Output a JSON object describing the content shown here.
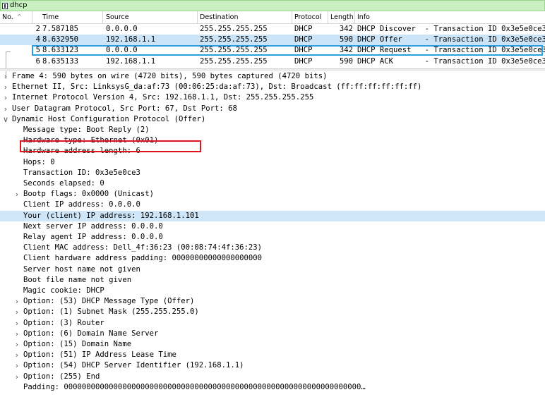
{
  "filter": {
    "value": "dhcp"
  },
  "packet_list": {
    "columns": [
      "No.",
      "Time",
      "Source",
      "Destination",
      "Protocol",
      "Length",
      "Info"
    ],
    "rows": [
      {
        "no": "2",
        "time": "7.587185",
        "source": "0.0.0.0",
        "destination": "255.255.255.255",
        "protocol": "DHCP",
        "length": "342",
        "info": "DHCP Discover  - Transaction ID 0x3e5e0ce3"
      },
      {
        "no": "4",
        "time": "8.632950",
        "source": "192.168.1.1",
        "destination": "255.255.255.255",
        "protocol": "DHCP",
        "length": "590",
        "info": "DHCP Offer     - Transaction ID 0x3e5e0ce3"
      },
      {
        "no": "5",
        "time": "8.633123",
        "source": "0.0.0.0",
        "destination": "255.255.255.255",
        "protocol": "DHCP",
        "length": "342",
        "info": "DHCP Request   - Transaction ID 0x3e5e0ce3"
      },
      {
        "no": "6",
        "time": "8.635133",
        "source": "192.168.1.1",
        "destination": "255.255.255.255",
        "protocol": "DHCP",
        "length": "590",
        "info": "DHCP ACK       - Transaction ID 0x3e5e0ce3"
      }
    ]
  },
  "details": [
    {
      "text": "Frame 4: 590 bytes on wire (4720 bits), 590 bytes captured (4720 bits)",
      "expander": "collapsed"
    },
    {
      "text": "Ethernet II, Src: LinksysG_da:af:73 (00:06:25:da:af:73), Dst: Broadcast (ff:ff:ff:ff:ff:ff)",
      "expander": "collapsed"
    },
    {
      "text": "Internet Protocol Version 4, Src: 192.168.1.1, Dst: 255.255.255.255",
      "expander": "collapsed"
    },
    {
      "text": "User Datagram Protocol, Src Port: 67, Dst Port: 68",
      "expander": "collapsed"
    },
    {
      "text": "Dynamic Host Configuration Protocol (Offer)",
      "expander": "expanded"
    },
    {
      "text": "Message type: Boot Reply (2)",
      "expander": "none"
    },
    {
      "text": "Hardware type: Ethernet (0x01)",
      "expander": "none"
    },
    {
      "text": "Hardware address length: 6",
      "expander": "none"
    },
    {
      "text": "Hops: 0",
      "expander": "none"
    },
    {
      "text": "Transaction ID: 0x3e5e0ce3",
      "expander": "none"
    },
    {
      "text": "Seconds elapsed: 0",
      "expander": "none"
    },
    {
      "text": "Bootp flags: 0x0000 (Unicast)",
      "expander": "collapsed"
    },
    {
      "text": "Client IP address: 0.0.0.0",
      "expander": "none"
    },
    {
      "text": "Your (client) IP address: 192.168.1.101",
      "expander": "none"
    },
    {
      "text": "Next server IP address: 0.0.0.0",
      "expander": "none"
    },
    {
      "text": "Relay agent IP address: 0.0.0.0",
      "expander": "none"
    },
    {
      "text": "Client MAC address: Dell_4f:36:23 (00:08:74:4f:36:23)",
      "expander": "none"
    },
    {
      "text": "Client hardware address padding: 00000000000000000000",
      "expander": "none"
    },
    {
      "text": "Server host name not given",
      "expander": "none"
    },
    {
      "text": "Boot file name not given",
      "expander": "none"
    },
    {
      "text": "Magic cookie: DHCP",
      "expander": "none"
    },
    {
      "text": "Option: (53) DHCP Message Type (Offer)",
      "expander": "collapsed"
    },
    {
      "text": "Option: (1) Subnet Mask (255.255.255.0)",
      "expander": "collapsed"
    },
    {
      "text": "Option: (3) Router",
      "expander": "collapsed"
    },
    {
      "text": "Option: (6) Domain Name Server",
      "expander": "collapsed"
    },
    {
      "text": "Option: (15) Domain Name",
      "expander": "collapsed"
    },
    {
      "text": "Option: (51) IP Address Lease Time",
      "expander": "collapsed"
    },
    {
      "text": "Option: (54) DHCP Server Identifier (192.168.1.1)",
      "expander": "collapsed"
    },
    {
      "text": "Option: (255) End",
      "expander": "collapsed"
    },
    {
      "text": "Padding: 000000000000000000000000000000000000000000000000000000000000000000…",
      "expander": "none"
    }
  ],
  "colors": {
    "selection": "#cce4f7",
    "selection_border": "#2b9fe0",
    "annotation": "#e0161f",
    "filter_bg": "#c8f0c0"
  }
}
